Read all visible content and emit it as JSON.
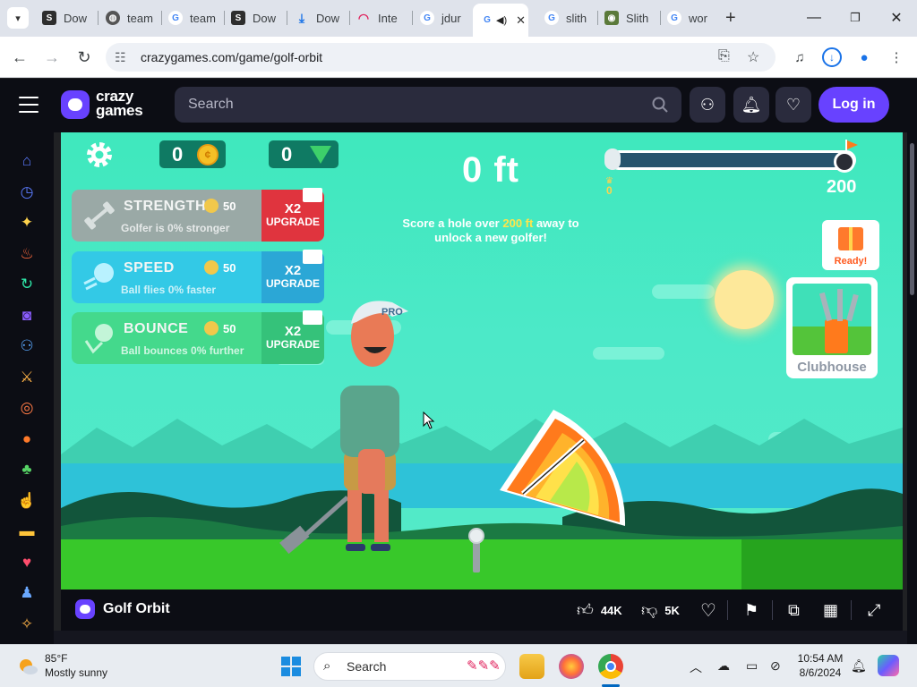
{
  "browser": {
    "tabs": [
      {
        "label": "Dow",
        "icon": "scribd-icon"
      },
      {
        "label": "team",
        "icon": "globe-icon"
      },
      {
        "label": "team",
        "icon": "google-icon"
      },
      {
        "label": "Dow",
        "icon": "scribd-icon"
      },
      {
        "label": "Dow",
        "icon": "download-icon"
      },
      {
        "label": "Inte",
        "icon": "speedometer-icon"
      },
      {
        "label": "jdur",
        "icon": "google-icon"
      },
      {
        "label": "G",
        "icon": "google-icon",
        "active": true,
        "audio": true
      },
      {
        "label": "slith",
        "icon": "google-icon"
      },
      {
        "label": "Slith",
        "icon": "slither-icon"
      },
      {
        "label": "wor",
        "icon": "google-icon"
      }
    ],
    "url": "crazygames.com/game/golf-orbit"
  },
  "site": {
    "logo_line1": "crazy",
    "logo_line2": "games",
    "search_placeholder": "Search",
    "login_label": "Log in",
    "accent_color": "#6842ff"
  },
  "sidebar": {
    "items": [
      {
        "name": "home-icon",
        "glyph": "⌂",
        "color": "#5b7bff"
      },
      {
        "name": "recent-icon",
        "glyph": "◷",
        "color": "#5b7bff"
      },
      {
        "name": "new-icon",
        "glyph": "✦",
        "color": "#ffd34d"
      },
      {
        "name": "trending-icon",
        "glyph": "♨",
        "color": "#ff6a3d"
      },
      {
        "name": "updated-icon",
        "glyph": "↻",
        "color": "#2ee6a8"
      },
      {
        "name": "originals-icon",
        "glyph": "◙",
        "color": "#8b5cff"
      },
      {
        "name": "multiplayer-icon",
        "glyph": "⚇",
        "color": "#5ba9ff"
      },
      {
        "name": "action-icon",
        "glyph": "⚔",
        "color": "#ffb347"
      },
      {
        "name": "adventure-icon",
        "glyph": "◎",
        "color": "#ff7a45"
      },
      {
        "name": "basketball-icon",
        "glyph": "●",
        "color": "#ff7a2a"
      },
      {
        "name": "casual-icon",
        "glyph": "♣",
        "color": "#57d366"
      },
      {
        "name": "clicker-icon",
        "glyph": "☝",
        "color": "#ff6aa8"
      },
      {
        "name": "driving-icon",
        "glyph": "▬",
        "color": "#ffc43a"
      },
      {
        "name": "card-icon",
        "glyph": "♥",
        "color": "#ff4d6d"
      },
      {
        "name": "controller-icon",
        "glyph": "♟",
        "color": "#6aa8ff"
      },
      {
        "name": "io-icon",
        "glyph": "✧",
        "color": "#ffb347"
      }
    ]
  },
  "game": {
    "coins": "0",
    "gems": "0",
    "distance": "0 ft",
    "progress_start": "0",
    "progress_goal": "200",
    "progress_fraction": 0.0,
    "unlock_pre": "Score a hole over ",
    "unlock_highlight": "200 ft",
    "unlock_post": " away to unlock a new golfer!",
    "upgrades": [
      {
        "title": "STRENGTH",
        "desc": "Golfer is 0% stronger",
        "cost": "50",
        "mult": "X2",
        "action": "UPGRADE",
        "body_color": "#9aa9a6",
        "btn_color": "#e0343e",
        "icon": "dumbbell-icon"
      },
      {
        "title": "SPEED",
        "desc": "Ball flies 0% faster",
        "cost": "50",
        "mult": "X2",
        "action": "UPGRADE",
        "body_color": "#33c9e6",
        "btn_color": "#2ba7d6",
        "icon": "fast-ball-icon"
      },
      {
        "title": "BOUNCE",
        "desc": "Ball bounces 0% further",
        "cost": "50",
        "mult": "X2",
        "action": "UPGRADE",
        "body_color": "#44d98c",
        "btn_color": "#35c27a",
        "icon": "bounce-ball-icon"
      }
    ],
    "gift_label": "Ready!",
    "clubhouse_label": "Clubhouse",
    "golfer_cap": "PRO"
  },
  "gamebar": {
    "title": "Golf Orbit",
    "likes": "44K",
    "dislikes": "5K"
  },
  "taskbar": {
    "temperature": "85°F",
    "condition": "Mostly sunny",
    "search_placeholder": "Search",
    "time": "10:54 AM",
    "date": "8/6/2024"
  }
}
